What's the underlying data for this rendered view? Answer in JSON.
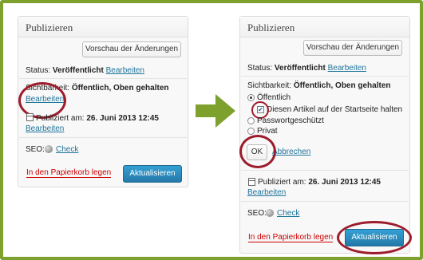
{
  "left": {
    "title": "Publizieren",
    "preview_button": "Vorschau der Änderungen",
    "status_label": "Status:",
    "status_value": "Veröffentlicht",
    "status_edit": "Bearbeiten",
    "visibility_label": "Sichtbarkeit:",
    "visibility_value": "Öffentlich, Oben gehalten",
    "visibility_edit": "Bearbeiten",
    "published_label": "Publiziert am:",
    "published_value": "26. Juni 2013 12:45",
    "published_edit": "Bearbeiten",
    "seo_label": "SEO:",
    "seo_check": "Check",
    "trash_link": "In den Papierkorb legen",
    "update_button": "Aktualisieren"
  },
  "right": {
    "title": "Publizieren",
    "preview_button": "Vorschau der Änderungen",
    "status_label": "Status:",
    "status_value": "Veröffentlicht",
    "status_edit": "Bearbeiten",
    "visibility_label": "Sichtbarkeit:",
    "visibility_value": "Öffentlich, Oben gehalten",
    "options": {
      "public": "Öffentlich",
      "sticky": "Diesen Artikel auf der Startseite halten",
      "password": "Passwortgeschützt",
      "private": "Privat"
    },
    "sticky_checked": true,
    "selected_option": "Öffentlich",
    "ok_button": "OK",
    "cancel_link": "Abbrechen",
    "published_label": "Publiziert am:",
    "published_value": "26. Juni 2013 12:45",
    "published_edit": "Bearbeiten",
    "seo_label": "SEO:",
    "seo_check": "Check",
    "trash_link": "In den Papierkorb legen",
    "update_button": "Aktualisieren"
  },
  "colors": {
    "frame": "#7ea02d",
    "arrow": "#7ea02d",
    "highlight_ring": "#9d1c2b",
    "link": "#21759b",
    "trash": "#cc0000",
    "primary_button": "#2479a8"
  },
  "icons": [
    "calendar-icon",
    "globe-icon",
    "arrow-right-icon",
    "checkmark-icon"
  ]
}
